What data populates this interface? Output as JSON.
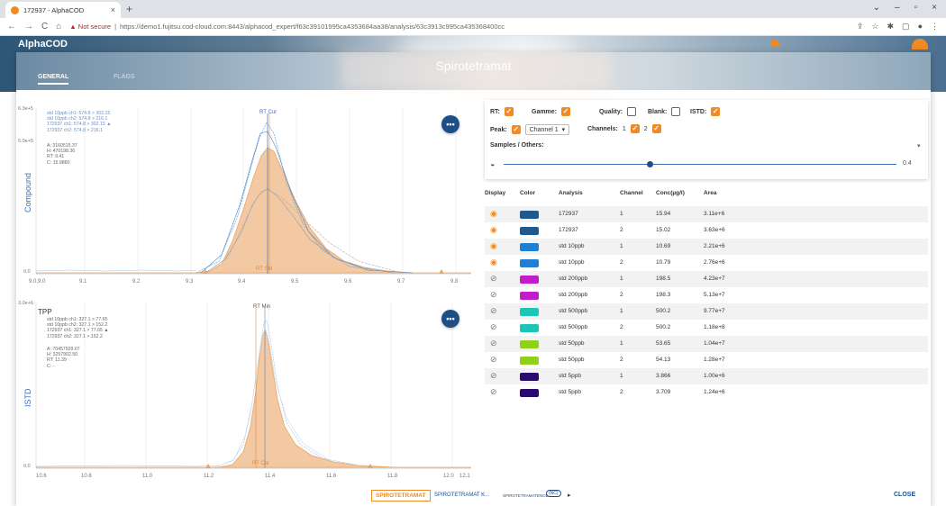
{
  "browser": {
    "tab_title": "172937 - AlphaCOD",
    "tab_close": "×",
    "new_tab": "+",
    "window_controls": [
      "⌄",
      "–",
      "▫",
      "×"
    ],
    "back": "←",
    "forward": "→",
    "reload": "C",
    "home": "⌂",
    "security_warning": "▲ Not secure",
    "url": "https://demo1.fujitsu.cod-cloud.com:8443/alphacod_expert/f63c39101995ca4353684aa38/analysis/63c3913c995ca435368400cc",
    "toolbar_icons": [
      "⇪",
      "☆",
      "✱",
      "▢",
      "●",
      "⋮"
    ]
  },
  "app": {
    "logo": "AlphaCOD"
  },
  "dialog": {
    "title": "Spirotetramat",
    "tabs": [
      {
        "label": "GENERAL",
        "active": true
      },
      {
        "label": "FLAGS",
        "active": false
      }
    ],
    "close_label": "CLOSE",
    "bottom_tabs": [
      {
        "label": "SPIROTETRAMAT",
        "active": true
      },
      {
        "label": "SPIROTETRAMAT K...",
        "active": false
      },
      {
        "label": "SPIROTETRAMATENOL",
        "active": false
      },
      {
        "label": "(NC)",
        "active": false
      },
      {
        "label": "▸",
        "active": false
      }
    ]
  },
  "chart_top": {
    "ylabel": "Compound",
    "y_ticks": [
      "6.3e+5",
      "5.0e+5",
      "0.0"
    ],
    "x_ticks": [
      "9.0,9.0",
      "9.1",
      "9.2",
      "9.3",
      "9.4",
      "9.5",
      "9.6",
      "9.7",
      "9.8"
    ],
    "rt_cur_label": "RT Cur",
    "rt_std_label": "RT Std",
    "legend": [
      "std 10ppb ch1: 574.8 > 302.15",
      "std 10ppb ch2: 574.8 > 216.1",
      "172937 ch1: 574.8 > 302.15 ▲",
      "172937 ch2: 574.8 > 216.1"
    ],
    "stats": [
      "A: 3160515.37",
      "H: 470198.36",
      "RT: 9.41",
      "C: 15.9860"
    ],
    "menu_label": "•••"
  },
  "chart_bottom": {
    "title": "TPP",
    "ylabel": "ISTD",
    "y_ticks": [
      "3.0e+6",
      "0.0"
    ],
    "x_ticks": [
      "10.6",
      "10.8",
      "11.0",
      "11.2",
      "11.4",
      "11.6",
      "11.8",
      "12.0",
      "12.1"
    ],
    "rt_cur_label": "RT Min",
    "rt_std_label": "RT Cal",
    "legend": [
      "std 10ppb ch1: 327.1 > 77.65",
      "std 10ppb ch2: 327.1 > 152.2",
      "172937 ch1: 327.1 > 77.65 ▲",
      "172937 ch2: 327.1 > 152.2"
    ],
    "stats": [
      "A: 70457929.07",
      "H: 3257902.50",
      "RT: 11.39",
      "C: -"
    ],
    "menu_label": "•••"
  },
  "filters": {
    "rt": {
      "label": "RT:",
      "checked": true
    },
    "gamme": {
      "label": "Gamme:",
      "checked": true
    },
    "quality": {
      "label": "Quality:",
      "checked": false
    },
    "blank": {
      "label": "Blank:",
      "checked": false
    },
    "istd": {
      "label": "ISTD:",
      "checked": true
    },
    "peak": {
      "label": "Peak:",
      "checked": true,
      "value": "Channel 1"
    },
    "channels": {
      "label": "Channels:",
      "items": [
        {
          "label": "1",
          "checked": true
        },
        {
          "label": "2",
          "checked": true
        }
      ]
    },
    "samples_label": "Samples / Others:",
    "opacity_value": "0.4",
    "opacity_fraction": 0.4
  },
  "table": {
    "headers": [
      "Display",
      "Color",
      "Analysis",
      "Channel",
      "Conc(µg/l)",
      "Area"
    ],
    "rows": [
      {
        "visible": true,
        "color": "#1f5a8f",
        "analysis": "172937",
        "channel": "1",
        "conc": "15.94",
        "area": "3.11e+6"
      },
      {
        "visible": true,
        "color": "#1f5a8f",
        "analysis": "172937",
        "channel": "2",
        "conc": "15.02",
        "area": "3.63e+6"
      },
      {
        "visible": true,
        "color": "#1e7fd3",
        "analysis": "std 10ppb",
        "channel": "1",
        "conc": "10.69",
        "area": "2.21e+6"
      },
      {
        "visible": true,
        "color": "#1e7fd3",
        "analysis": "std 10ppb",
        "channel": "2",
        "conc": "10.79",
        "area": "2.76e+6"
      },
      {
        "visible": false,
        "color": "#c21dc8",
        "analysis": "std 200ppb",
        "channel": "1",
        "conc": "198.5",
        "area": "4.23e+7"
      },
      {
        "visible": false,
        "color": "#c21dc8",
        "analysis": "std 200ppb",
        "channel": "2",
        "conc": "198.3",
        "area": "5.13e+7"
      },
      {
        "visible": false,
        "color": "#19c7b4",
        "analysis": "std 500ppb",
        "channel": "1",
        "conc": "500.2",
        "area": "9.77e+7"
      },
      {
        "visible": false,
        "color": "#19c7b4",
        "analysis": "std 500ppb",
        "channel": "2",
        "conc": "500.2",
        "area": "1.18e+8"
      },
      {
        "visible": false,
        "color": "#8fd118",
        "analysis": "std 50ppb",
        "channel": "1",
        "conc": "53.65",
        "area": "1.04e+7"
      },
      {
        "visible": false,
        "color": "#8fd118",
        "analysis": "std 50ppb",
        "channel": "2",
        "conc": "54.13",
        "area": "1.28e+7"
      },
      {
        "visible": false,
        "color": "#2a0a6e",
        "analysis": "std 5ppb",
        "channel": "1",
        "conc": "3.866",
        "area": "1.00e+6"
      },
      {
        "visible": false,
        "color": "#2a0a6e",
        "analysis": "std 5ppb",
        "channel": "2",
        "conc": "3.709",
        "area": "1.24e+6"
      }
    ]
  }
}
